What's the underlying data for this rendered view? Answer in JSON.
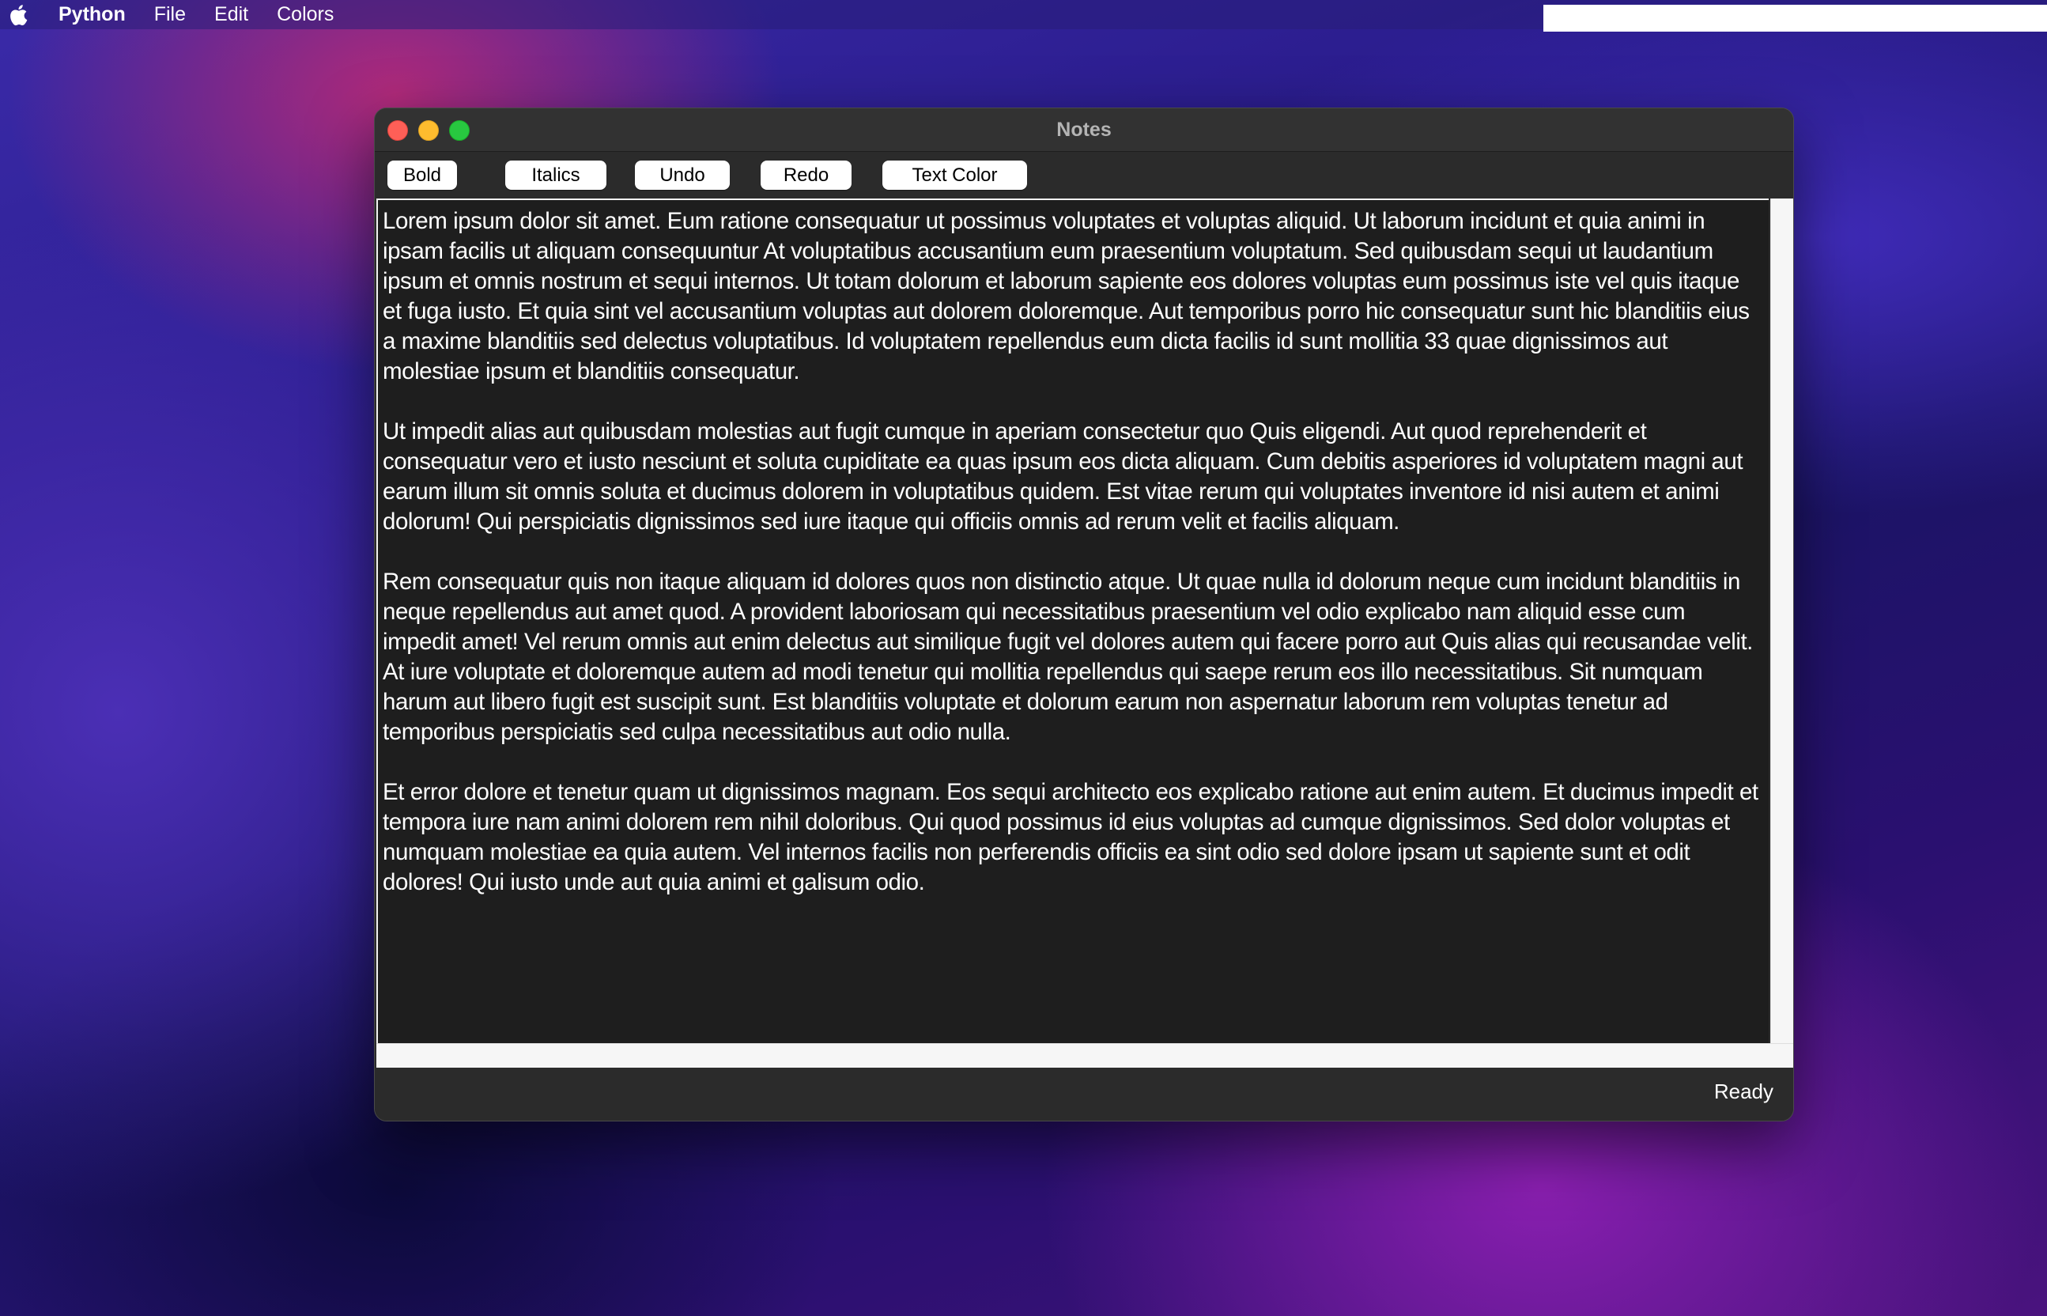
{
  "menubar": {
    "app_name": "Python",
    "items": [
      "File",
      "Edit",
      "Colors"
    ]
  },
  "window": {
    "title": "Notes"
  },
  "toolbar": {
    "buttons": [
      "Bold",
      "Italics",
      "Undo",
      "Redo",
      "Text Color"
    ]
  },
  "editor": {
    "paragraphs": [
      "Lorem ipsum dolor sit amet. Eum ratione consequatur ut possimus voluptates et voluptas aliquid. Ut laborum incidunt et quia animi in ipsam facilis ut aliquam consequuntur At voluptatibus accusantium eum praesentium voluptatum. Sed quibusdam sequi ut laudantium ipsum et omnis nostrum et sequi internos. Ut totam dolorum et laborum sapiente eos dolores voluptas eum possimus iste vel quis itaque et fuga iusto. Et quia sint vel accusantium voluptas aut dolorem doloremque. Aut temporibus porro hic consequatur sunt hic blanditiis eius a maxime blanditiis sed delectus voluptatibus. Id voluptatem repellendus eum dicta facilis id sunt mollitia 33 quae dignissimos aut molestiae ipsum et blanditiis consequatur.",
      "Ut impedit alias aut quibusdam molestias aut fugit cumque in aperiam consectetur quo Quis eligendi. Aut quod reprehenderit et consequatur vero et iusto nesciunt et soluta cupiditate ea quas ipsum eos dicta aliquam. Cum debitis asperiores id voluptatem magni aut earum illum sit omnis soluta et ducimus dolorem in voluptatibus quidem. Est vitae rerum qui voluptates inventore id nisi autem et animi dolorum! Qui perspiciatis dignissimos sed iure itaque qui officiis omnis ad rerum velit et facilis aliquam.",
      "Rem consequatur quis non itaque aliquam id dolores quos non distinctio atque. Ut quae nulla id dolorum neque cum incidunt blanditiis in neque repellendus aut amet quod. A provident laboriosam qui necessitatibus praesentium vel odio explicabo nam aliquid esse cum impedit amet! Vel rerum omnis aut enim delectus aut similique fugit vel dolores autem qui facere porro aut Quis alias qui recusandae velit. At iure voluptate et doloremque autem ad modi tenetur qui mollitia repellendus qui saepe rerum eos illo necessitatibus. Sit numquam harum aut libero fugit est suscipit sunt. Est blanditiis voluptate et dolorum earum non aspernatur laborum rem voluptas tenetur ad temporibus perspiciatis sed culpa necessitatibus aut odio nulla.",
      "Et error dolore et tenetur quam ut dignissimos magnam. Eos sequi architecto eos explicabo ratione aut enim autem. Et ducimus impedit et tempora iure nam animi dolorem rem nihil doloribus. Qui quod possimus id eius voluptas ad cumque dignissimos. Sed dolor voluptas et numquam molestiae ea quia autem. Vel internos facilis non perferendis officiis ea sint odio sed dolore ipsam ut sapiente sunt et odit dolores! Qui iusto unde aut quia animi et galisum odio."
    ]
  },
  "status": {
    "text": "Ready"
  },
  "colors": {
    "editor_background": "#1e1e1e",
    "editor_text": "#ffffff",
    "window_chrome": "#2b2b2b",
    "close": "#fe5f57",
    "minimize": "#febc2e",
    "maximize": "#28c840"
  },
  "icons": [
    "apple-logo-icon",
    "close-window-icon",
    "minimize-window-icon",
    "maximize-window-icon"
  ]
}
